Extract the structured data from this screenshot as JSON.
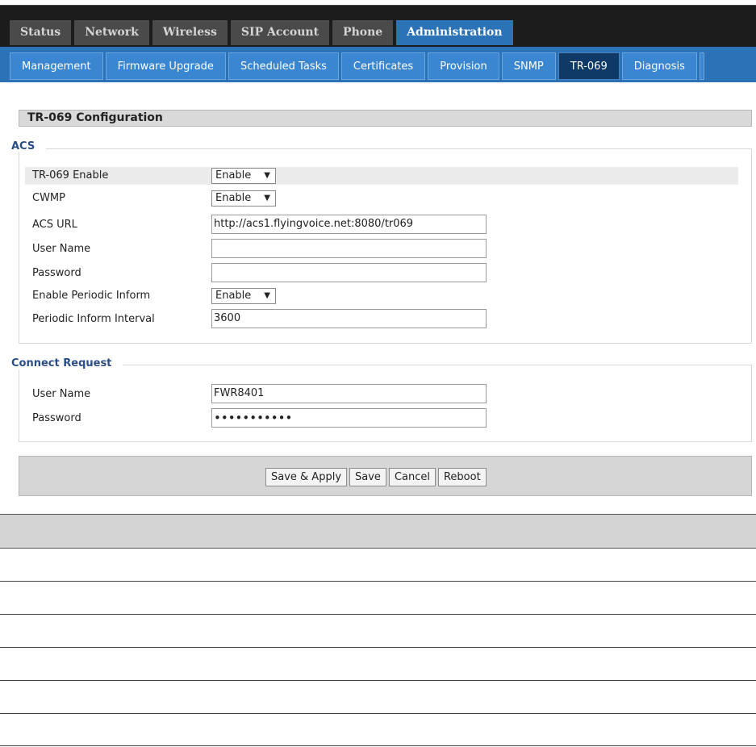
{
  "main_tabs": [
    "Status",
    "Network",
    "Wireless",
    "SIP Account",
    "Phone",
    "Administration"
  ],
  "sub_tabs": [
    "Management",
    "Firmware Upgrade",
    "Scheduled Tasks",
    "Certificates",
    "Provision",
    "SNMP",
    "TR-069",
    "Diagnosis"
  ],
  "section_title": "TR-069 Configuration",
  "acs": {
    "legend": "ACS",
    "tr069_enable": {
      "label": "TR-069 Enable",
      "value": "Enable"
    },
    "cwmp": {
      "label": "CWMP",
      "value": "Enable"
    },
    "acs_url": {
      "label": "ACS URL",
      "value": "http://acs1.flyingvoice.net:8080/tr069"
    },
    "user_name": {
      "label": "User Name",
      "value": ""
    },
    "password": {
      "label": "Password",
      "value": ""
    },
    "periodic_inform": {
      "label": "Enable Periodic Inform",
      "value": "Enable"
    },
    "periodic_interval": {
      "label": "Periodic Inform Interval",
      "value": "3600"
    }
  },
  "connect_request": {
    "legend": "Connect Request",
    "user_name": {
      "label": "User Name",
      "value": "FWR8401"
    },
    "password": {
      "label": "Password",
      "value": "•••••••••••"
    }
  },
  "buttons": {
    "save_apply": "Save & Apply",
    "save": "Save",
    "cancel": "Cancel",
    "reboot": "Reboot"
  },
  "colors": {
    "accent": "#2b72b6",
    "active_sub_tab": "#0f3a68",
    "legend": "#2b4d86"
  },
  "icons": {
    "dropdown": "triangle-down-icon"
  }
}
